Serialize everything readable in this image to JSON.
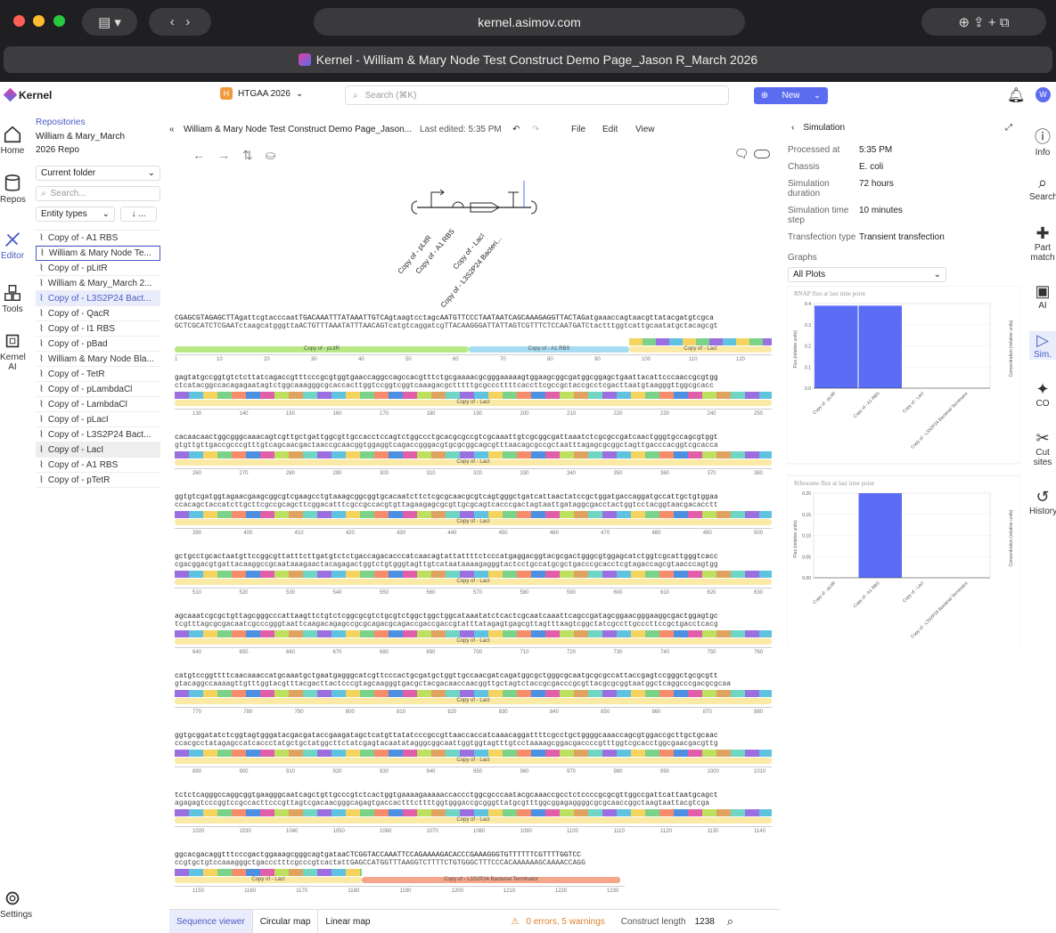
{
  "browser": {
    "url": "kernel.asimov.com",
    "tab_title": "Kernel - William & Mary Node Test Construct Demo Page_Jason R_March 2026"
  },
  "app": {
    "logo": "Kernel",
    "workspace": "HTGAA 2026",
    "workspace_badge": "H",
    "search_placeholder": "Search (⌘K)",
    "new_label": "New",
    "avatar": "W"
  },
  "left_nav": [
    {
      "label": "Home",
      "icon": "home-icon"
    },
    {
      "label": "Repos",
      "icon": "database-icon"
    },
    {
      "label": "Editor",
      "icon": "editor-icon"
    },
    {
      "label": "Tools",
      "icon": "tools-icon"
    },
    {
      "label": "Kernel AI",
      "icon": "chip-icon"
    },
    {
      "label": "Settings",
      "icon": "gear-icon"
    }
  ],
  "sidebar": {
    "crumb": "Repositories",
    "repo": "William & Mary_March 2026 Repo",
    "folder": "Current folder",
    "search_placeholder": "Search...",
    "entity_types": "Entity types",
    "sort": "↓ ...",
    "files": [
      "Copy of - A1 RBS",
      "William & Mary Node Te...",
      "Copy of - pLitR",
      "William & Mary_March 2...",
      "Copy of - L3S2P24 Bact...",
      "Copy of - QacR",
      "Copy of - I1 RBS",
      "Copy of - pBad",
      "William & Mary Node Bla...",
      "Copy of - TetR",
      "Copy of - pLambdaCl",
      "Copy of - LambdaCl",
      "Copy of - pLacI",
      "Copy of - L3S2P24 Bact...",
      "Copy of - LacI",
      "Copy of - A1 RBS",
      "Copy of - pTetR"
    ]
  },
  "editor": {
    "title": "William & Mary Node Test Construct Demo Page_Jason...",
    "last_edited": "Last edited: 5:35 PM",
    "menu": [
      "File",
      "Edit",
      "View"
    ],
    "glyph_labels": [
      "Copy of - pLitR",
      "Copy of - A1 RBS",
      "Copy of - LacI",
      "Copy of - L3S2P24 Bacteri..."
    ]
  },
  "sequence": {
    "blocks": [
      {
        "top": "CGAGCGTAGAGCTTAgattcgtacccaatTGACAAATTTATAAATTGTCAgtaagtcctagcAATGTTCCCTAATAATCAGCAAAGAGGTTACTAGatgaaaccagtaacgttatacgatgtcgca",
        "bot": "GCTCGCATCTCGAATctaagcatgggttaACTGTTTAAATATTTAACAGTcatgtcaggatcgTTACAAGGGATTATTAGTCGTTTCTCCAATGATCtactttggtcattgcaatatgctacagcgt",
        "ticks": [
          "1",
          "10",
          "20",
          "30",
          "40",
          "50",
          "60",
          "70",
          "80",
          "90",
          "100",
          "110",
          "120"
        ],
        "anns": [
          "Copy of - pLitR",
          "Copy of - A1 RBS",
          "Copy of - LacI"
        ]
      },
      {
        "top": "gagtatgccggtgtctcttatcagaccgtttcccgcgtggtgaaccaggccagccacgtttctgcgaaaacgcgggaaaaagtggaagcggcgatggcggagctgaattacattcccaaccgcgtgg",
        "bot": "ctcatacggccacagagaatagtctggcaaagggcgcaccacttggtccggtcggtcaaagacgctttttgcgcccttttcaccttcgccgctaccgcctcgacttaatgtaagggttggcgcacc",
        "ticks": [
          "130",
          "140",
          "150",
          "160",
          "170",
          "180",
          "190",
          "200",
          "210",
          "220",
          "230",
          "240",
          "250"
        ],
        "anns": [
          "Copy of - LacI"
        ]
      },
      {
        "top": "cacaacaactggcgggcaaacagtcgttgctgattggcgttgccacctccagtctggccctgcacgcgccgtcgcaaattgtcgcggcgattaaatctcgcgccgatcaactgggtgccagcgtggt",
        "bot": "gtgttgttgaccgcccgtttgtcagcaacgactaaccgcaacggtggaggtcagaccgggacgtgcgcggcagcgtttaacagcgccgctaatttagagcgcggctagttgacccacggtcgcacca",
        "ticks": [
          "260",
          "270",
          "280",
          "290",
          "300",
          "310",
          "320",
          "330",
          "340",
          "350",
          "360",
          "370",
          "380"
        ],
        "anns": [
          "Copy of - LacI"
        ]
      },
      {
        "top": "ggtgtcgatggtagaacgaagcggcgtcgaagcctgtaaagcggcggtgcacaatcttctcgcgcaacgcgtcagtgggctgatcattaactatccgctggatgaccaggatgccattgctgtggaa",
        "bot": "ccacagctaccatcttgcttcgccgcagcttcggacatttcgccgccacgtgttagaagagcgcgttgcgcagtcacccgactagtaattgataggcgacctactggtcctacggtaacgacacctt",
        "ticks": [
          "390",
          "400",
          "410",
          "420",
          "430",
          "440",
          "450",
          "460",
          "470",
          "480",
          "490",
          "500"
        ],
        "anns": [
          "Copy of - LacI"
        ]
      },
      {
        "top": "gctgcctgcactaatgttccggcgttatttcttgatgtctctgaccagacacccatcaacagtattattttctcccatgaggacggtacgcgactgggcgtggagcatctggtcgcattgggtcacc",
        "bot": "cgacggacgtgattacaaggccgcaataaagaactacagagactggtctgtgggtagttgtcataataaaagagggtactcctgccatgcgctgacccgcacctcgtagaccagcgtaacccagtgg",
        "ticks": [
          "510",
          "520",
          "530",
          "540",
          "550",
          "560",
          "570",
          "580",
          "590",
          "600",
          "610",
          "620",
          "630"
        ],
        "anns": [
          "Copy of - LacI"
        ]
      },
      {
        "top": "agcaaatcgcgctgttagcgggcccattaagttctgtctcggcgcgtctgcgtctggctggctggcataaatatctcactcgcaatcaaattcagccgatagcggaacgggaaggcgactggagtgc",
        "bot": "tcgtttagcgcgacaatcgcccgggtaattcaagacagagccgcgcagacgcagaccgaccgaccgtatttatagagtgagcgttagtttaagtcggctatcgccttgcccttccgctgacctcacg",
        "ticks": [
          "640",
          "650",
          "660",
          "670",
          "680",
          "690",
          "700",
          "710",
          "720",
          "730",
          "740",
          "750",
          "760"
        ],
        "anns": [
          "Copy of - LacI"
        ]
      },
      {
        "top": "catgtccggttttcaacaaaccatgcaaatgctgaatgagggcatcgttcccactgcgatgctggttgccaacgatcagatggcgctgggcgcaatgcgcgccattaccgagtccgggctgcgcgtt",
        "bot": "gtacaggccaaaagttgtttggtacgtttacgacttactcccgtagcaagggtgacgctacgacaaccaacggttgctagtctaccgcgacccgcgttacgcgcggtaatggctcaggcccgacgcgcaa",
        "ticks": [
          "770",
          "780",
          "790",
          "800",
          "810",
          "820",
          "830",
          "840",
          "850",
          "860",
          "870",
          "880"
        ],
        "anns": [
          "Copy of - LacI"
        ]
      },
      {
        "top": "ggtgcggatatctcggtagtgggatacgacgataccgaagatagctcatgttatatcccgccgttaaccaccatcaaacaggattttcgcctgctggggcaaaccagcgtggaccgcttgctgcaac",
        "bot": "ccacgcctatagagccatcaccctatgctgctatggcttctatcgagtacaatatagggcggcaattggtggtagtttgtcctaaaagcggacgaccccgtttggtcgcacctggcgaacgacgttg",
        "ticks": [
          "890",
          "900",
          "910",
          "920",
          "930",
          "940",
          "950",
          "960",
          "970",
          "980",
          "990",
          "1000",
          "1010"
        ],
        "anns": [
          "Copy of - LacI"
        ]
      },
      {
        "top": "tctctcagggccaggcggtgaagggcaatcagctgttgcccgtctcactggtgaaaagaaaaaccaccctggcgcccaatacgcaaaccgcctctccccgcgcgttggccgattcattaatgcagct",
        "bot": "agagagtcccggtccgccacttcccgttagtcgacaacgggcagagtgaccactttcttttggtgggaccgcgggttatgcgtttggcggagaggggcgcgcaaccggctaagtaattacgtcga",
        "ticks": [
          "1020",
          "1030",
          "1040",
          "1050",
          "1060",
          "1070",
          "1080",
          "1090",
          "1100",
          "1110",
          "1120",
          "1130",
          "1140"
        ],
        "anns": [
          "Copy of - LacI"
        ]
      },
      {
        "top": "ggcacgacaggtttcccgactggaaagcgggcagtgataaCTCGGTACCAAATTCCAGAAAAGACACCCGAAAGGGTGTTTTTTCGTTTTGGTCC",
        "bot": "ccgtgctgtccaaagggctgaccctttcgcccgtcactattGAGCCATGGTTTAAGGTCTTTTCTGTGGGCTTTCCCACAAAAAAGCAAAACCAGG",
        "ticks": [
          "1150",
          "1160",
          "1170",
          "1180",
          "1190",
          "1200",
          "1210",
          "1220",
          "1230"
        ],
        "anns": [
          "Copy of - LacI",
          "Copy of - L3S2P24 Bacterial Terminator"
        ]
      }
    ]
  },
  "simulation": {
    "title": "Simulation",
    "fields": [
      {
        "k": "Processed at",
        "v": "5:35 PM"
      },
      {
        "k": "Chassis",
        "v": "E. coli"
      },
      {
        "k": "Simulation duration",
        "v": "72 hours"
      },
      {
        "k": "Simulation time step",
        "v": "10 minutes"
      },
      {
        "k": "Transfection type",
        "v": "Transient transfection"
      }
    ],
    "graphs_label": "Graphs",
    "graphs_select": "All Plots"
  },
  "chart_data": [
    {
      "type": "bar",
      "title": "RNAP flux at last time point",
      "ylabel": "Flux (relative units)",
      "y2label": "Concentration (relative units)",
      "categories": [
        "Copy of - pLitR",
        "Copy of - A1 RBS",
        "Copy of - LacI",
        "Copy of - L3S2P24 Bacterial Terminator"
      ],
      "values": [
        0.39,
        0.39,
        0,
        0
      ],
      "ylim": [
        0,
        0.4
      ],
      "yticks": [
        "0.0",
        "0.1",
        "0.2",
        "0.3",
        "0.4"
      ]
    },
    {
      "type": "bar",
      "title": "Ribosome flux at last time point",
      "ylabel": "Flux (relative units)",
      "y2label": "Concentration (relative units)",
      "categories": [
        "Copy of - pLitR",
        "Copy of - A1 RBS",
        "Copy of - LacI",
        "Copy of - L3S2P24 Bacterial Terminator"
      ],
      "values": [
        0,
        0.2,
        0,
        0
      ],
      "ylim": [
        0,
        0.2
      ],
      "yticks": [
        "0.00",
        "0.05",
        "0.10",
        "0.15",
        "0.20"
      ]
    }
  ],
  "right_nav": [
    {
      "label": "Info",
      "icon": "info-icon"
    },
    {
      "label": "Search",
      "icon": "search-icon"
    },
    {
      "label": "Part match",
      "icon": "puzzle-icon"
    },
    {
      "label": "AI",
      "icon": "chip-icon"
    },
    {
      "label": "Sim.",
      "icon": "play-icon"
    },
    {
      "label": "CO",
      "icon": "sparkle-icon"
    },
    {
      "label": "Cut sites",
      "icon": "scissors-icon"
    },
    {
      "label": "History",
      "icon": "history-icon"
    }
  ],
  "bottom": {
    "tabs": [
      "Sequence viewer",
      "Circular map",
      "Linear map"
    ],
    "status": "0 errors, 5 warnings",
    "length_label": "Construct length",
    "length": "1238"
  },
  "colors": {
    "accent": "#4b5cc4",
    "new_button": "#5b6cf0",
    "bar": "#5b6cf5",
    "pLitR": "#b8e986",
    "A1RBS": "#a6dcef",
    "LacI": "#fbe9a6",
    "terminator": "#f4a58a"
  }
}
